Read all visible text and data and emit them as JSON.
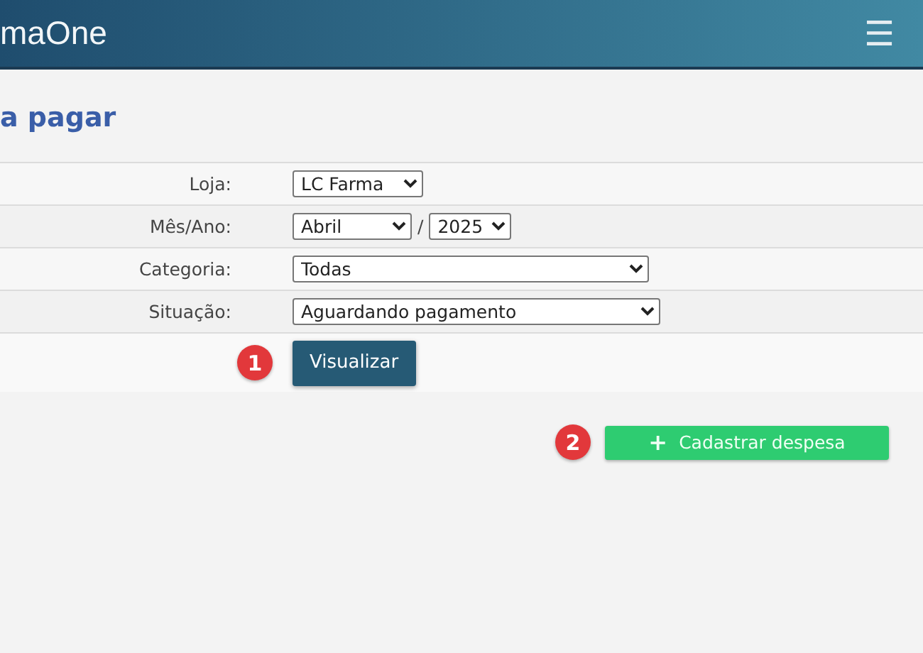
{
  "header": {
    "brand": "maOne",
    "menu_icon": "☰"
  },
  "page_title": "a pagar",
  "form": {
    "rows": [
      {
        "label": "Loja:",
        "fields": [
          {
            "value": "LC Farma"
          }
        ]
      },
      {
        "label": "Mês/Ano:",
        "fields": [
          {
            "value": "Abril"
          },
          {
            "value": "2025"
          }
        ],
        "separator": "/"
      },
      {
        "label": "Categoria:",
        "fields": [
          {
            "value": "Todas"
          }
        ]
      },
      {
        "label": "Situação:",
        "fields": [
          {
            "value": "Aguardando pagamento"
          }
        ]
      }
    ],
    "submit": {
      "label": "Visualizar",
      "step": "1"
    }
  },
  "add_button": {
    "label": "Cadastrar despesa",
    "icon": "+",
    "step": "2"
  }
}
